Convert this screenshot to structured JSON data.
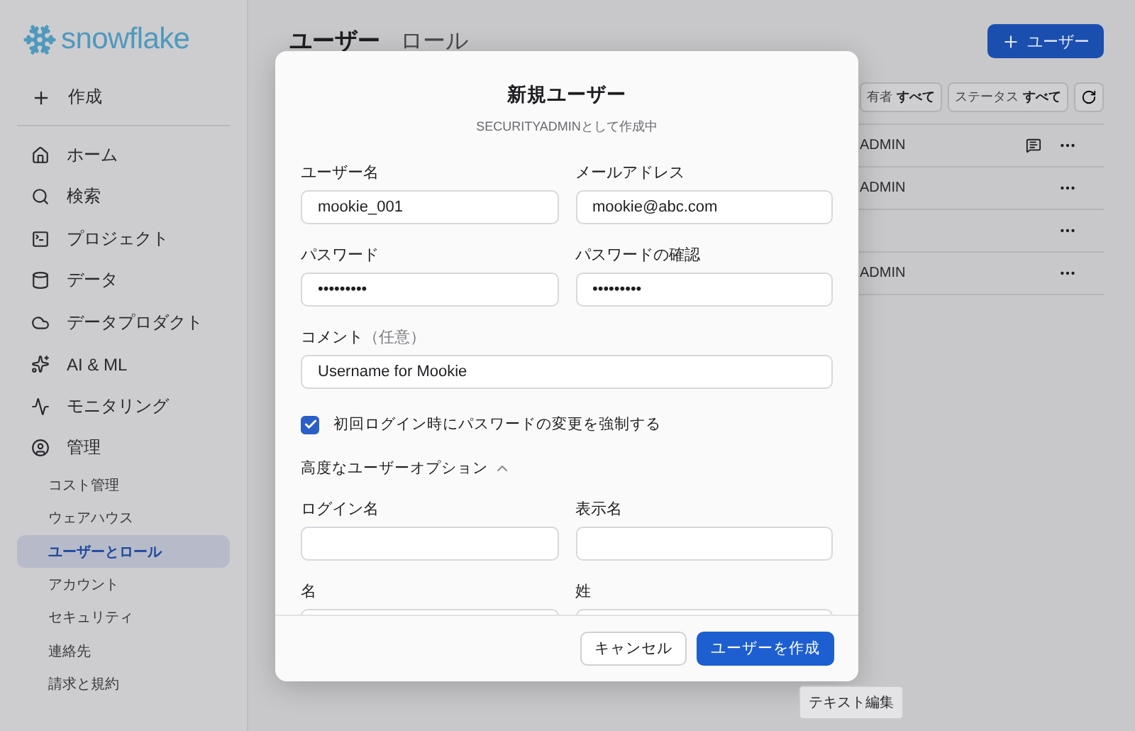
{
  "sidebar": {
    "logo": "snowflake",
    "create": "作成",
    "items": [
      {
        "label": "ホーム"
      },
      {
        "label": "検索"
      },
      {
        "label": "プロジェクト"
      },
      {
        "label": "データ"
      },
      {
        "label": "データプロダクト"
      },
      {
        "label": "AI & ML"
      },
      {
        "label": "モニタリング"
      },
      {
        "label": "管理"
      }
    ],
    "sub_items": [
      {
        "label": "コスト管理",
        "selected": false
      },
      {
        "label": "ウェアハウス",
        "selected": false
      },
      {
        "label": "ユーザーとロール",
        "selected": true
      },
      {
        "label": "アカウント",
        "selected": false
      },
      {
        "label": "セキュリティ",
        "selected": false
      },
      {
        "label": "連絡先",
        "selected": false
      },
      {
        "label": "請求と規約",
        "selected": false
      }
    ]
  },
  "main": {
    "tabs": [
      {
        "label": "ユーザー",
        "selected": true
      },
      {
        "label": "ロール",
        "selected": false
      }
    ],
    "add_button": "ユーザー",
    "filters": [
      {
        "label": "有者",
        "value": "すべて"
      },
      {
        "label": "ステータス",
        "value": "すべて"
      }
    ],
    "rows": [
      {
        "column_1": "ADMIN",
        "comment": true
      },
      {
        "column_1": "ADMIN",
        "comment": false
      },
      {
        "comment": false
      },
      {
        "column_1": "ADMIN",
        "comment": false
      }
    ]
  },
  "dialog": {
    "title": "新規ユーザー",
    "subtitle": "SECURITYADMINとして作成中",
    "fields": [
      {
        "label": "ユーザー名",
        "value": "mookie_001"
      },
      {
        "label": "メールアドレス",
        "value": "mookie@abc.com"
      },
      {
        "label": "パスワード",
        "value": "•••••••••"
      },
      {
        "label": "パスワードの確認",
        "value": "•••••••••"
      }
    ],
    "comment": {
      "label": "コメント",
      "hint": "（任意）",
      "value": "Username for Mookie"
    },
    "checkbox": {
      "label": "初回ログイン時にパスワードの変更を強制する",
      "checked": true
    },
    "advanced": {
      "label": "高度なユーザーオプション",
      "expanded": true
    },
    "advanced_fields": [
      {
        "label": "ログイン名"
      },
      {
        "label": "表示名"
      },
      {
        "label": "名"
      },
      {
        "label": "姓"
      }
    ],
    "buttons": {
      "cancel": "キャンセル",
      "create": "ユーザーを作成"
    }
  },
  "tooltip": "テキスト編集"
}
